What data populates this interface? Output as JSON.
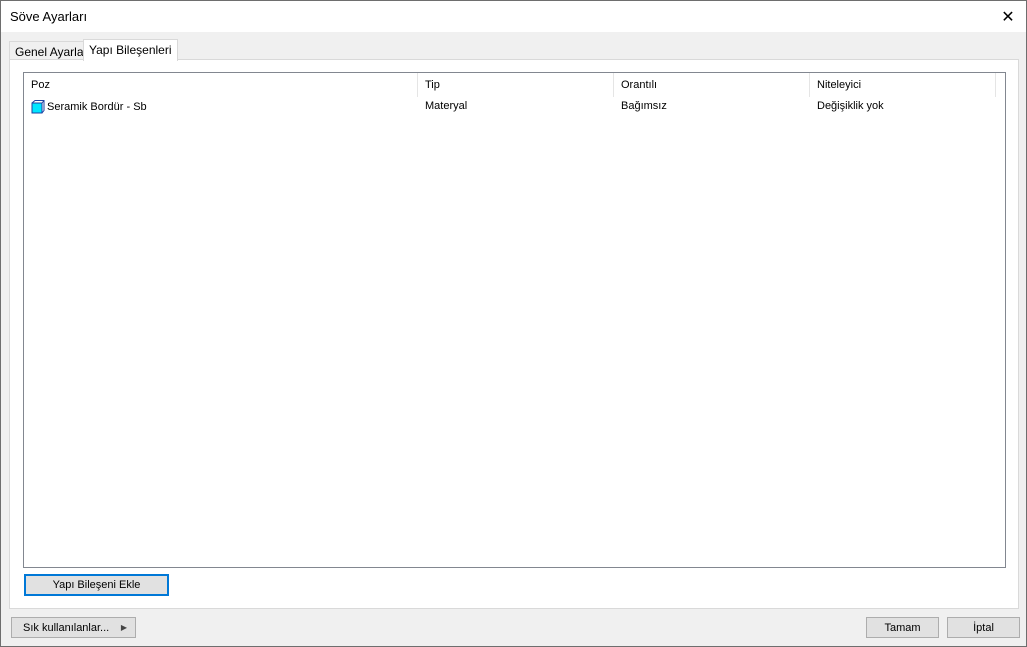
{
  "window": {
    "title": "Söve Ayarları"
  },
  "tabs": [
    {
      "label": "Genel Ayarlar"
    },
    {
      "label": "Yapı Bileşenleri"
    }
  ],
  "table": {
    "columns": [
      "Poz",
      "Tip",
      "Orantılı",
      "Niteleyici"
    ],
    "rows": [
      {
        "poz": "Seramik Bordür - Sb",
        "tip": "Materyal",
        "orantili": "Bağımsız",
        "niteleyici": "Değişiklik yok"
      }
    ]
  },
  "buttons": {
    "add": "Yapı Bileşeni Ekle",
    "favorites": "Sık kullanılanlar...",
    "ok": "Tamam",
    "cancel": "İptal"
  }
}
